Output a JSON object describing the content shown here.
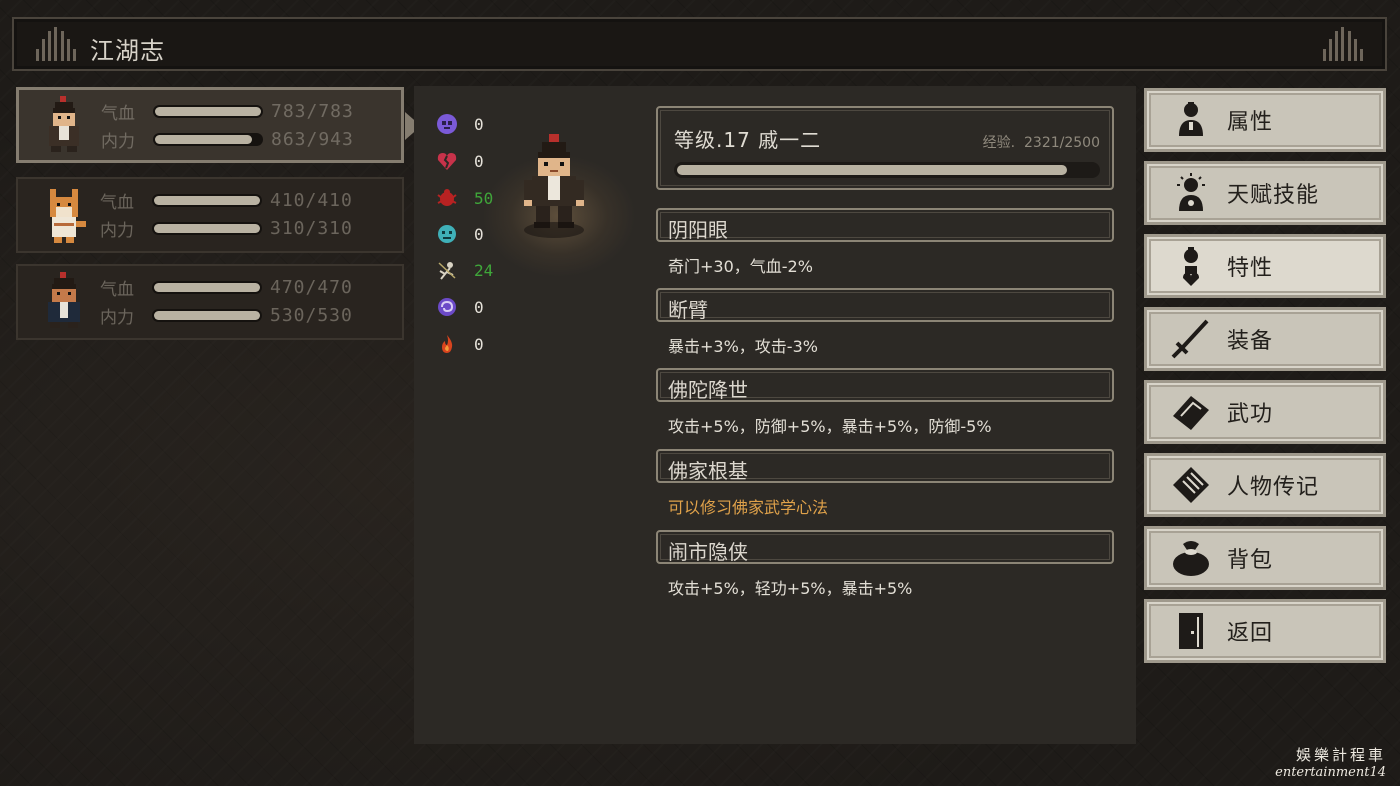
{
  "header": {
    "title": "江湖志"
  },
  "party": [
    {
      "hp_label": "气血",
      "hp_value": "783/783",
      "hp_fill": 1.0,
      "mp_label": "内力",
      "mp_value": "863/943",
      "mp_fill": 0.915
    },
    {
      "hp_label": "气血",
      "hp_value": "410/410",
      "hp_fill": 1.0,
      "mp_label": "内力",
      "mp_value": "310/310",
      "mp_fill": 1.0
    },
    {
      "hp_label": "气血",
      "hp_value": "470/470",
      "hp_fill": 1.0,
      "mp_label": "内力",
      "mp_value": "530/530",
      "mp_fill": 1.0
    }
  ],
  "resistances": [
    {
      "icon": "purple-skull-icon",
      "value": "0"
    },
    {
      "icon": "broken-heart-icon",
      "value": "0"
    },
    {
      "icon": "red-bug-icon",
      "value": "50"
    },
    {
      "icon": "cyan-face-icon",
      "value": "0"
    },
    {
      "icon": "bound-figure-icon",
      "value": "24"
    },
    {
      "icon": "purple-spiral-icon",
      "value": "0"
    },
    {
      "icon": "flame-icon",
      "value": "0"
    }
  ],
  "character": {
    "level_text": "等级.17 戚一二",
    "exp_label": "经验.",
    "exp_value": "2321/2500",
    "exp_fill": 0.928
  },
  "traits": [
    {
      "name": "阴阳眼",
      "desc": "奇门+30，气血-2%"
    },
    {
      "name": "断臂",
      "desc": "暴击+3%，攻击-3%"
    },
    {
      "name": "佛陀降世",
      "desc": "攻击+5%，防御+5%，暴击+5%，防御-5%"
    },
    {
      "name": "佛家根基",
      "desc": "可以修习佛家武学心法"
    },
    {
      "name": "闹市隐侠",
      "desc": "攻击+5%，轻功+5%，暴击+5%"
    }
  ],
  "menu": [
    {
      "label": "属性",
      "icon": "person-icon"
    },
    {
      "label": "天赋技能",
      "icon": "talent-icon"
    },
    {
      "label": "特性",
      "icon": "trait-icon"
    },
    {
      "label": "装备",
      "icon": "sword-icon"
    },
    {
      "label": "武功",
      "icon": "martial-book-icon"
    },
    {
      "label": "人物传记",
      "icon": "biography-scroll-icon"
    },
    {
      "label": "背包",
      "icon": "bag-icon"
    },
    {
      "label": "返回",
      "icon": "door-icon"
    }
  ],
  "colors": {
    "accent_orange": "#e0a24a",
    "green_value": "#3fa73a",
    "menu_bg": "#c9c5b9"
  },
  "watermark": {
    "line1": "娛樂計程車",
    "line2": "entertainment14"
  }
}
